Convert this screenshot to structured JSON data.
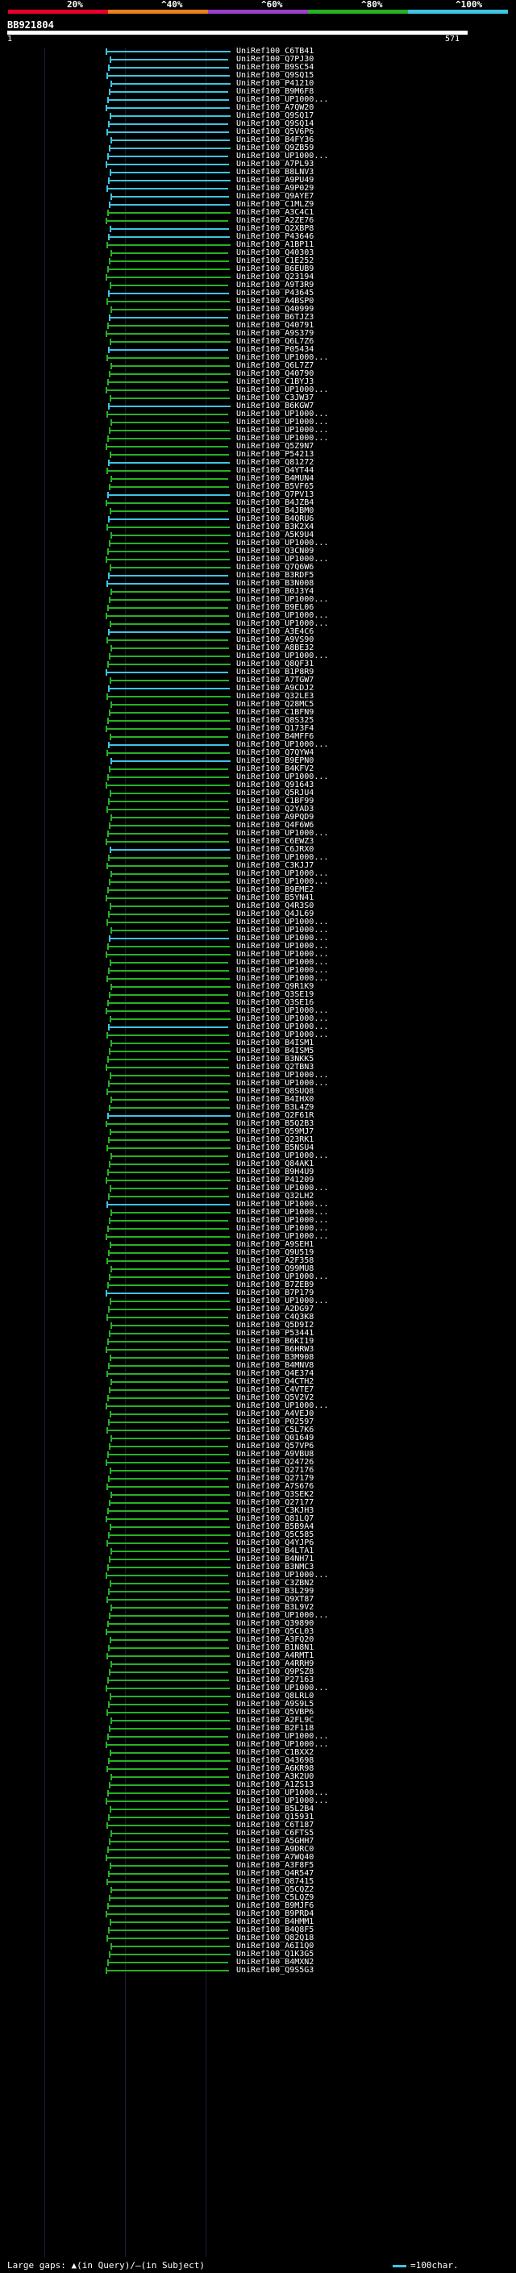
{
  "legend": {
    "ticks": [
      "20%",
      "^40%",
      "^60%",
      "^80%",
      "^100%"
    ],
    "colors": [
      "#e8002b",
      "#e8801e",
      "#9c3fcb",
      "#27b126",
      "#3ec4e4"
    ]
  },
  "query": {
    "id": "BB921804",
    "start": "1",
    "end": "571"
  },
  "hits": [
    "UniRef100_C6TB41",
    "UniRef100_Q7PJ30",
    "UniRef100_B9SC54",
    "UniRef100_Q9SQ15",
    "UniRef100_P41210",
    "UniRef100_B9M6F8",
    "UniRef100_UP1000...",
    "UniRef100_A7QW20",
    "UniRef100_Q9SQ17",
    "UniRef100_Q9SQ14",
    "UniRef100_Q5V6P6",
    "UniRef100_B4FY36",
    "UniRef100_Q9ZB59",
    "UniRef100_UP1000...",
    "UniRef100_A7PL93",
    "UniRef100_B8LNV3",
    "UniRef100_A9PU49",
    "UniRef100_A9P029",
    "UniRef100_Q9AYE7",
    "UniRef100_C1MLZ9",
    "UniRef100_A3C4C1",
    "UniRef100_A2ZE76",
    "UniRef100_Q2XBP8",
    "UniRef100_P43646",
    "UniRef100_A1BP11",
    "UniRef100_Q40303",
    "UniRef100_C1E252",
    "UniRef100_B6EUB9",
    "UniRef100_Q23194",
    "UniRef100_A9T3R9",
    "UniRef100_P43645",
    "UniRef100_A4BSP0",
    "UniRef100_Q40999",
    "UniRef100_B6TJZ3",
    "UniRef100_Q40791",
    "UniRef100_A9S379",
    "UniRef100_Q6L7Z6",
    "UniRef100_P05434",
    "UniRef100_UP1000...",
    "UniRef100_Q6L7Z7",
    "UniRef100_Q40790",
    "UniRef100_C1BYJ3",
    "UniRef100_UP1000...",
    "UniRef100_C3JW37",
    "UniRef100_B6KGW7",
    "UniRef100_UP1000...",
    "UniRef100_UP1000...",
    "UniRef100_UP1000...",
    "UniRef100_UP1000...",
    "UniRef100_Q5Z9N7",
    "UniRef100_P54213",
    "UniRef100_Q81272",
    "UniRef100_Q4YT44",
    "UniRef100_B4MUN4",
    "UniRef100_B5VF65",
    "UniRef100_Q7PV13",
    "UniRef100_B4JZB4",
    "UniRef100_B4JBM0",
    "UniRef100_B4QRU6",
    "UniRef100_B3K2X4",
    "UniRef100_A5K9U4",
    "UniRef100_UP1000...",
    "UniRef100_Q3CN09",
    "UniRef100_UP1000...",
    "UniRef100_Q7Q6W6",
    "UniRef100_B3RDF5",
    "UniRef100_B3N008",
    "UniRef100_B0J3Y4",
    "UniRef100_UP1000...",
    "UniRef100_B9EL06",
    "UniRef100_UP1000...",
    "UniRef100_UP1000...",
    "UniRef100_A3E4C6",
    "UniRef100_A9VS90",
    "UniRef100_A8BE32",
    "UniRef100_UP1000...",
    "UniRef100_Q8QF31",
    "UniRef100_B1P8R9",
    "UniRef100_A7TGW7",
    "UniRef100_A9CDJ2",
    "UniRef100_Q32LE3",
    "UniRef100_Q28MC5",
    "UniRef100_C1BFN9",
    "UniRef100_Q8S325",
    "UniRef100_Q173F4",
    "UniRef100_B4MFF6",
    "UniRef100_UP1000...",
    "UniRef100_Q7QYW4",
    "UniRef100_B9EPN0",
    "UniRef100_B4KFV2",
    "UniRef100_UP1000...",
    "UniRef100_Q91643",
    "UniRef100_Q5RJU4",
    "UniRef100_C1BF99",
    "UniRef100_Q2YAD3",
    "UniRef100_A9PQD9",
    "UniRef100_Q4F6W6",
    "UniRef100_UP1000...",
    "UniRef100_C6EWZ3",
    "UniRef100_C6JRX0",
    "UniRef100_UP1000...",
    "UniRef100_C3KJJ7",
    "UniRef100_UP1000...",
    "UniRef100_UP1000...",
    "UniRef100_B9EME2",
    "UniRef100_B5YN41",
    "UniRef100_Q4R3S0",
    "UniRef100_Q4JL69",
    "UniRef100_UP1000...",
    "UniRef100_UP1000...",
    "UniRef100_UP1000...",
    "UniRef100_UP1000...",
    "UniRef100_UP1000...",
    "UniRef100_UP1000...",
    "UniRef100_UP1000...",
    "UniRef100_UP1000...",
    "UniRef100_Q9R1K9",
    "UniRef100_Q3SE19",
    "UniRef100_Q3SE16",
    "UniRef100_UP1000...",
    "UniRef100_UP1000...",
    "UniRef100_UP1000...",
    "UniRef100_UP1000...",
    "UniRef100_B4ISM1",
    "UniRef100_B4ISM5",
    "UniRef100_B3NKK5",
    "UniRef100_Q2TBN3",
    "UniRef100_UP1000...",
    "UniRef100_UP1000...",
    "UniRef100_Q8SUQ8",
    "UniRef100_B4IHX0",
    "UniRef100_B3L4Z9",
    "UniRef100_Q2F61R",
    "UniRef100_B5Q2B3",
    "UniRef100_Q59MJ7",
    "UniRef100_Q23RK1",
    "UniRef100_B5NSU4",
    "UniRef100_UP1000...",
    "UniRef100_Q84AK1",
    "UniRef100_B9H4U9",
    "UniRef100_P41209",
    "UniRef100_UP1000...",
    "UniRef100_Q32LH2",
    "UniRef100_UP1000...",
    "UniRef100_UP1000...",
    "UniRef100_UP1000...",
    "UniRef100_UP1000...",
    "UniRef100_UP1000...",
    "UniRef100_A9SEH1",
    "UniRef100_Q9U519",
    "UniRef100_A2F358",
    "UniRef100_Q99MU8",
    "UniRef100_UP1000...",
    "UniRef100_B7ZEB9",
    "UniRef100_B7P179",
    "UniRef100_UP1000...",
    "UniRef100_A2DG97",
    "UniRef100_C4Q3K8",
    "UniRef100_Q5D9I2",
    "UniRef100_P53441",
    "UniRef100_B6KI19",
    "UniRef100_B6HRW3",
    "UniRef100_B3M908",
    "UniRef100_B4MNV8",
    "UniRef100_Q4E374",
    "UniRef100_Q4CTH2",
    "UniRef100_C4VTE7",
    "UniRef100_Q5V2V2",
    "UniRef100_UP1000...",
    "UniRef100_A4VEJ0",
    "UniRef100_P02597",
    "UniRef100_C5L7K6",
    "UniRef100_Q01649",
    "UniRef100_Q57VP6",
    "UniRef100_A9VBU8",
    "UniRef100_Q24726",
    "UniRef100_Q27176",
    "UniRef100_Q27179",
    "UniRef100_A7S676",
    "UniRef100_Q3SEK2",
    "UniRef100_Q27177",
    "UniRef100_C3KJH3",
    "UniRef100_Q81LQ7",
    "UniRef100_B5B9A4",
    "UniRef100_Q5C585",
    "UniRef100_Q4YJP6",
    "UniRef100_B4LTA1",
    "UniRef100_B4NH71",
    "UniRef100_B3NMC3",
    "UniRef100_UP1000...",
    "UniRef100_C3ZBN2",
    "UniRef100_B3L299",
    "UniRef100_Q9XT87",
    "UniRef100_B3L9V2",
    "UniRef100_UP1000...",
    "UniRef100_Q39890",
    "UniRef100_Q5CL03",
    "UniRef100_A3FQ20",
    "UniRef100_B1N8N1",
    "UniRef100_A4RMT1",
    "UniRef100_A4RRH9",
    "UniRef100_Q9PSZ8",
    "UniRef100_P27163",
    "UniRef100_UP1000...",
    "UniRef100_Q8LRL0",
    "UniRef100_A9S9L5",
    "UniRef100_Q5VBP6",
    "UniRef100_A2FL9C",
    "UniRef100_B2F118",
    "UniRef100_UP1000...",
    "UniRef100_UP1000...",
    "UniRef100_C1BXX2",
    "UniRef100_Q43698",
    "UniRef100_A6KR98",
    "UniRef100_A3K2U0",
    "UniRef100_A1ZS13",
    "UniRef100_UP1000...",
    "UniRef100_UP1000...",
    "UniRef100_B5L2B4",
    "UniRef100_Q15931",
    "UniRef100_C6T187",
    "UniRef100_C6FTS5",
    "UniRef100_A5GHH7",
    "UniRef100_A9DRC0",
    "UniRef100_A7WQ40",
    "UniRef100_A3F8F5",
    "UniRef100_Q4R547",
    "UniRef100_Q87415",
    "UniRef100_Q5CQZ2",
    "UniRef100_C5LQZ9",
    "UniRef100_B9MJF6",
    "UniRef100_B9PRD4",
    "UniRef100_B4HMM1",
    "UniRef100_B4Q8F5",
    "UniRef100_Q82Q18",
    "UniRef100_A6I1Q0",
    "UniRef100_Q1K3G5",
    "UniRef100_B4MXN2",
    "UniRef100_Q9S5G3"
  ],
  "footer": {
    "large_gaps": "Large gaps: ▲(in Query)/—(in Subject)",
    "scale": "=100char."
  }
}
